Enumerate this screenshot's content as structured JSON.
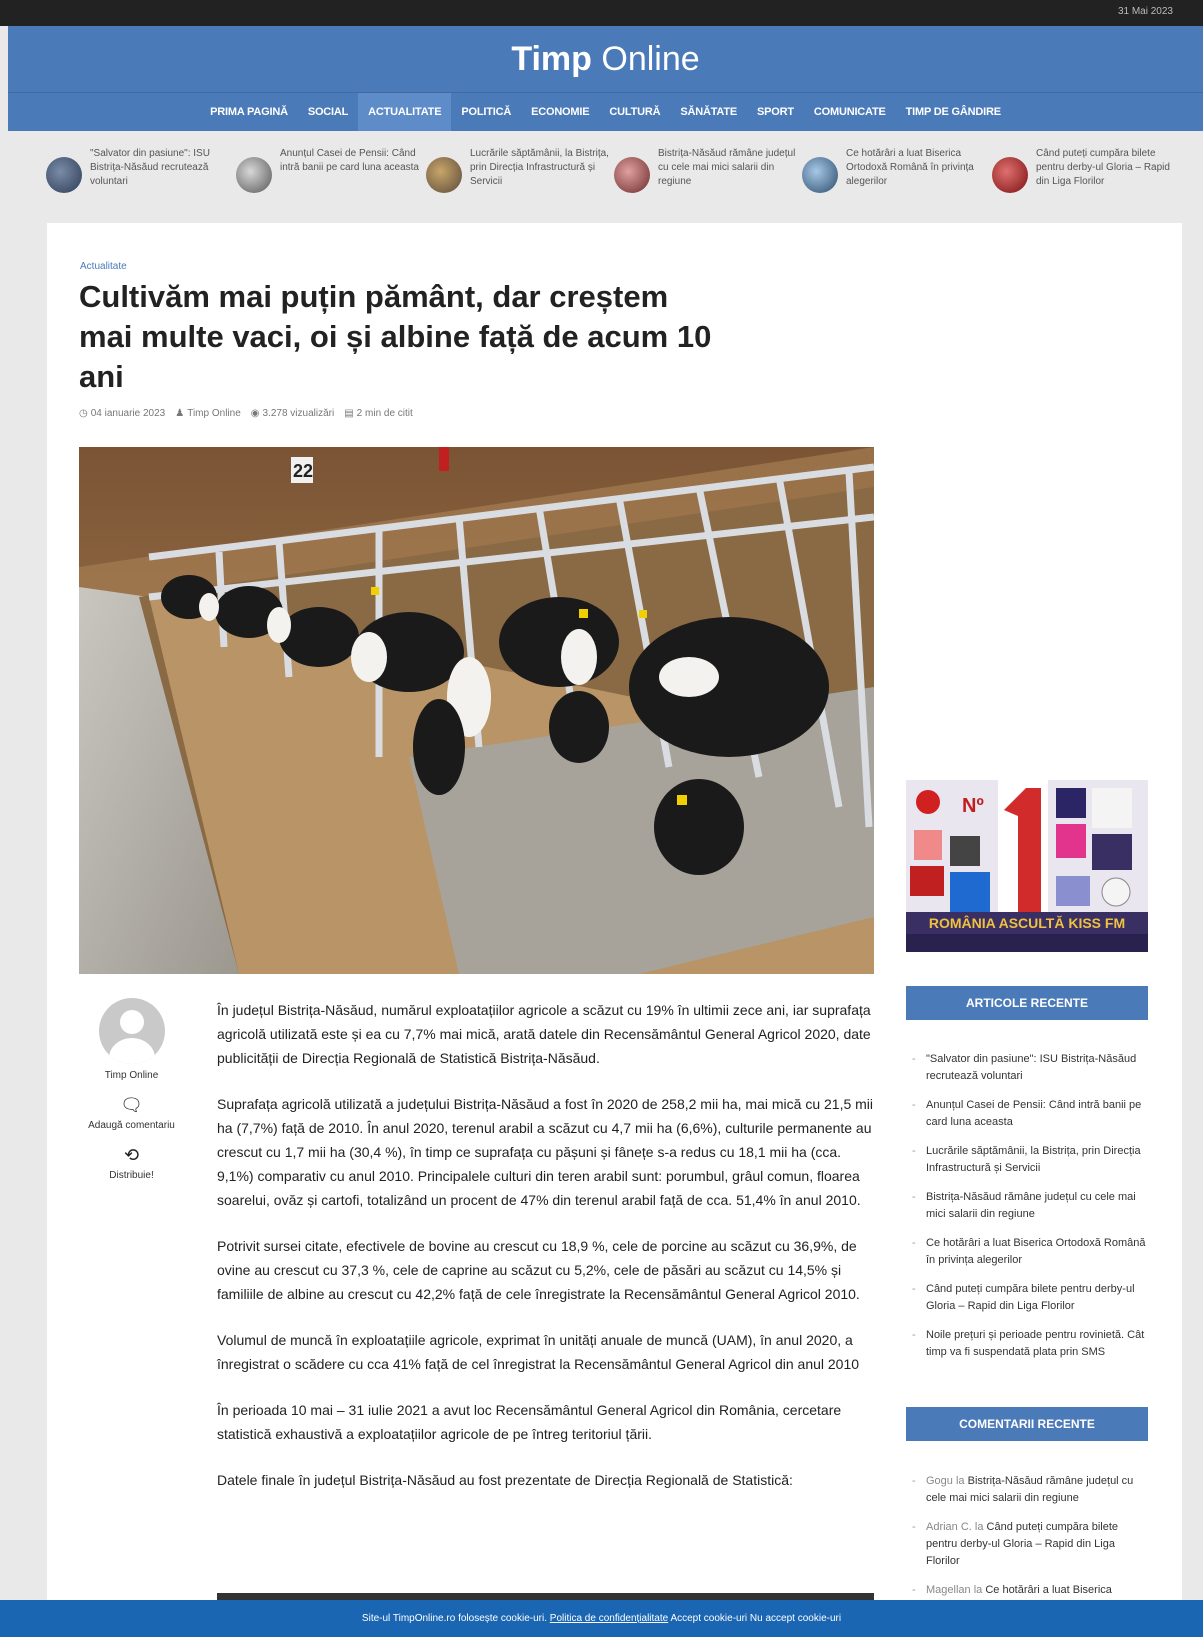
{
  "topbar": {
    "right_text": "31 Mai 2023"
  },
  "header": {
    "brand_bold": "Timp",
    "brand_light": "Online"
  },
  "nav": {
    "items": [
      "PRIMA PAGINĂ",
      "SOCIAL",
      "ACTUALITATE",
      "POLITICĂ",
      "ECONOMIE",
      "CULTURĂ",
      "SĂNĂTATE",
      "SPORT",
      "COMUNICATE",
      "TIMP DE GÂNDIRE"
    ],
    "active": "ACTUALITATE"
  },
  "ticker": [
    {
      "text": "\"Salvator din pasiune\": ISU Bistrița-Năsăud recrutează voluntari"
    },
    {
      "text": "Anunțul Casei de Pensii: Când intră banii pe card luna aceasta"
    },
    {
      "text": "Lucrările săptămânii, la Bistrița, prin Direcția Infrastructură și Servicii"
    },
    {
      "text": "Bistrița-Năsăud rămâne județul cu cele mai mici salarii din regiune"
    },
    {
      "text": "Ce hotărâri a luat Biserica Ortodoxă Română în privința alegerilor"
    },
    {
      "text": "Când puteți cumpăra bilete pentru derby-ul Gloria – Rapid din Liga Florilor"
    }
  ],
  "article": {
    "category": "Actualitate",
    "title": "Cultivăm mai puțin pământ, dar creștem mai multe vaci, oi și albine față de acum 10 ani",
    "date": "04 ianuarie 2023",
    "author": "Timp Online",
    "views": "3.278 vizualizări",
    "read_time": "2 min de citit",
    "paragraphs": [
      "În județul Bistrița-Năsăud, numărul exploatațiilor agricole a scăzut cu 19% în ultimii zece ani, iar suprafața agricolă utilizată este și ea cu 7,7% mai mică, arată datele din Recensământul General Agricol 2020, date publicității de Direcția Regională de Statistică Bistrița-Năsăud.",
      "Suprafața agricolă utilizată a județului Bistrița-Năsăud a fost în 2020 de 258,2 mii ha, mai mică cu 21,5 mii ha (7,7%) față de 2010. În anul 2020, terenul arabil a scăzut cu 4,7 mii ha (6,6%), culturile permanente au crescut cu 1,7 mii ha (30,4 %), în timp ce suprafața cu pășuni și fânețe s-a redus cu 18,1 mii ha (cca. 9,1%) comparativ cu anul 2010. Principalele culturi din teren arabil sunt: porumbul, grâul comun, floarea soarelui, ovăz și cartofi, totalizând un procent de 47% din terenul arabil față de cca. 51,4% în anul 2010.",
      "Potrivit sursei citate, efectivele de bovine au crescut cu 18,9 %, cele de porcine au scăzut cu 36,9%, de ovine au crescut cu 37,3 %, cele de caprine au scăzut cu 5,2%, cele de păsări au scăzut cu 14,5% și familiile de albine au crescut cu 42,2% față de cele înregistrate la Recensământul General Agricol 2010.",
      "Volumul de muncă în exploatațiile agricole, exprimat în unități anuale de muncă (UAM), în anul 2020, a înregistrat o scădere cu cca 41% față de cel înregistrat la Recensământul General Agricol din anul 2010",
      "În perioada 10 mai – 31 iulie 2021 a avut loc Recensământul General Agricol din România, cercetare statistică exhaustivă a exploatațiilor agricole de pe întreg teritoriul țării.",
      "Datele finale în județul Bistrița-Năsăud au fost prezentate de Direcția Regională de Statistică:"
    ]
  },
  "author_box": {
    "name": "Timp Online",
    "comment_label": "Adaugă comentariu",
    "share_label": "Distribuie!"
  },
  "ad": {
    "top_label": "Nº",
    "bottom_text": "ROMÂNIA ASCULTĂ KISS FM"
  },
  "sidebar": {
    "recent_title": "ARTICOLE RECENTE",
    "recent": [
      "\"Salvator din pasiune\": ISU Bistrița-Năsăud recrutează voluntari",
      "Anunțul Casei de Pensii: Când intră banii pe card luna aceasta",
      "Lucrările săptămânii, la Bistrița, prin Direcția Infrastructură și Servicii",
      "Bistrița-Năsăud rămâne județul cu cele mai mici salarii din regiune",
      "Ce hotărâri a luat Biserica Ortodoxă Română în privința alegerilor",
      "Când puteți cumpăra bilete pentru derby-ul Gloria – Rapid din Liga Florilor",
      "Noile prețuri și perioade pentru rovinietă. Cât timp va fi suspendată plata prin SMS"
    ],
    "comments_title": "COMENTARII RECENTE",
    "comments": [
      {
        "who": "Gogu",
        "sep": " la ",
        "what": "Bistrița-Năsăud rămâne județul cu cele mai mici salarii din regiune"
      },
      {
        "who": "Adrian C.",
        "sep": " la ",
        "what": "Când puteți cumpăra bilete pentru derby-ul Gloria – Rapid din Liga Florilor"
      },
      {
        "who": "Magellan",
        "sep": " la ",
        "what": "Ce hotărâri a luat Biserica"
      }
    ]
  },
  "cookie": {
    "text": "Site-ul TimpOnline.ro folosește cookie-uri.",
    "policy": "Politica de confidențialitate",
    "accept": "Accept cookie-uri",
    "reject": "Nu accept cookie-uri"
  }
}
